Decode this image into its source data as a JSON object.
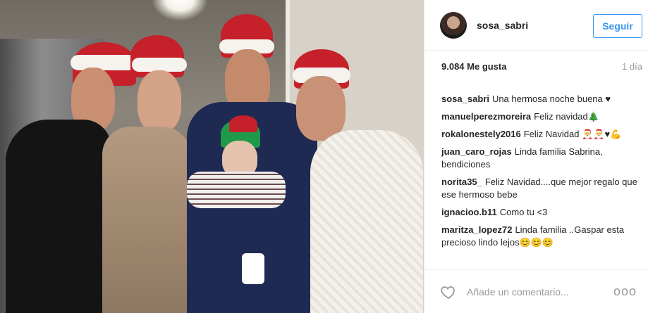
{
  "header": {
    "username": "sosa_sabri",
    "follow_label": "Seguir"
  },
  "meta": {
    "likes": "9.084 Me gusta",
    "time": "1 día"
  },
  "comments": [
    {
      "user": "sosa_sabri",
      "text": "Una hermosa noche buena ♥"
    },
    {
      "user": "manuelperezmoreira",
      "text": "Feliz navidad🎄"
    },
    {
      "user": "rokalonestely2016",
      "text": "Feliz Navidad 🎅🎅♥💪"
    },
    {
      "user": "juan_caro_rojas",
      "text": "Linda familia Sabrina, bendiciones"
    },
    {
      "user": "norita35_",
      "text": "Feliz Navidad....que mejor regalo que ese hermoso bebe"
    },
    {
      "user": "ignacioo.b11",
      "text": "Como tu <3"
    },
    {
      "user": "maritza_lopez72",
      "text": "Linda familia ..Gaspar esta precioso lindo lejos😊😊😊"
    }
  ],
  "footer": {
    "add_comment_placeholder": "Añade un comentario...",
    "more_label": "ooo"
  },
  "icons": {
    "heart": "heart-icon",
    "more": "more-options-icon"
  },
  "colors": {
    "follow": "#3897f0",
    "secondary_text": "#999999",
    "primary_text": "#262626"
  }
}
